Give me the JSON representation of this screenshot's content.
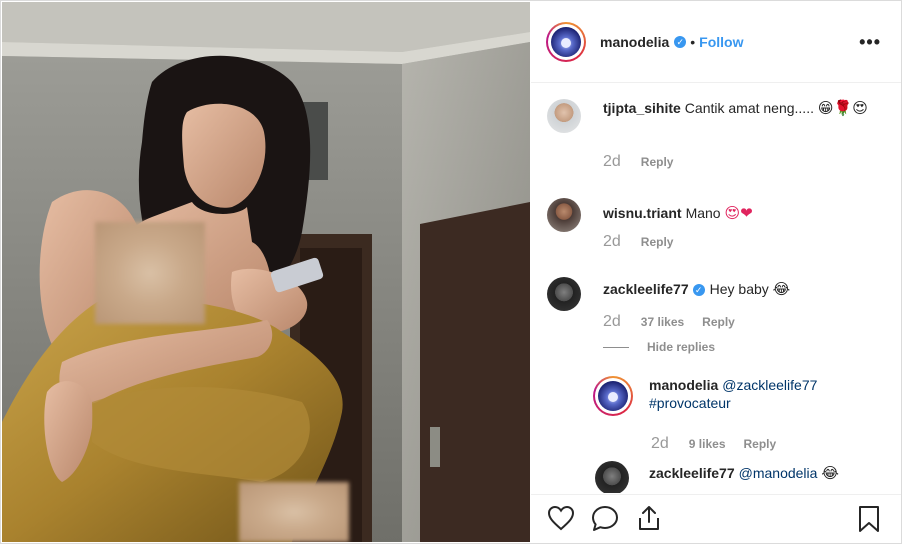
{
  "post": {
    "username": "manodelia",
    "follow_label": "Follow",
    "separator": "•",
    "more_label": "•••"
  },
  "comments": [
    {
      "username": "tjipta_sihite",
      "text": "Cantik amat neng.....",
      "emoji": "😁🌹😍",
      "time": "2d",
      "reply_label": "Reply"
    },
    {
      "username": "wisnu.triant",
      "text": "Mano",
      "emoji": "😍❤",
      "time": "2d",
      "reply_label": "Reply"
    },
    {
      "username": "zackleelife77",
      "text": "Hey baby",
      "emoji": "😂",
      "time": "2d",
      "likes": "37 likes",
      "reply_label": "Reply",
      "hide_replies_label": "Hide replies",
      "verified": true
    }
  ],
  "replies": [
    {
      "username": "manodelia",
      "mention": "@zackleelife77",
      "text": "#provocateur",
      "time": "2d",
      "likes": "9 likes",
      "reply_label": "Reply"
    },
    {
      "username": "zackleelife77",
      "mention": "@manodelia",
      "emoji": "😂"
    }
  ],
  "footer": {
    "icons": [
      "heart-icon",
      "comment-icon",
      "share-icon",
      "bookmark-icon"
    ]
  },
  "colors": {
    "accent": "#3897f0",
    "muted": "#8e8e8e",
    "text": "#262626",
    "mention": "#003569"
  }
}
